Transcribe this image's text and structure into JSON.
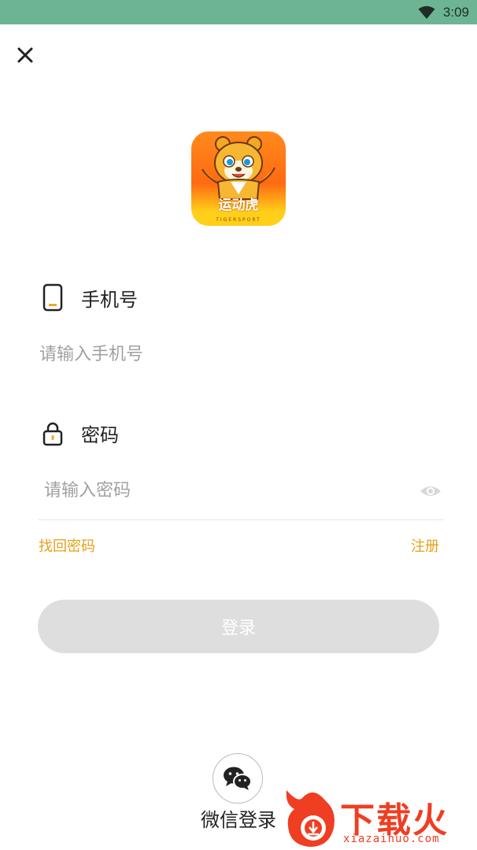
{
  "status_bar": {
    "time": "3:09",
    "icons": [
      "wifi-icon"
    ],
    "background": "#6db592"
  },
  "header": {
    "close_icon": "close-icon"
  },
  "logo": {
    "label": "运动虎",
    "sublabel": "TIGERSPORT"
  },
  "phone": {
    "label": "手机号",
    "placeholder": "请输入手机号",
    "icon": "phone-icon"
  },
  "password": {
    "label": "密码",
    "placeholder": "请输入密码",
    "icon": "lock-icon",
    "toggle_icon": "eye-icon"
  },
  "links": {
    "forgot": "找回密码",
    "register": "注册",
    "color": "#e6a118"
  },
  "login_button": {
    "label": "登录",
    "background": "#dedede"
  },
  "wechat": {
    "label": "微信登录",
    "icon": "wechat-icon"
  },
  "watermark": {
    "title": "下载火",
    "subtitle": "xiazaihuo.com",
    "color": "#ef3e22"
  }
}
